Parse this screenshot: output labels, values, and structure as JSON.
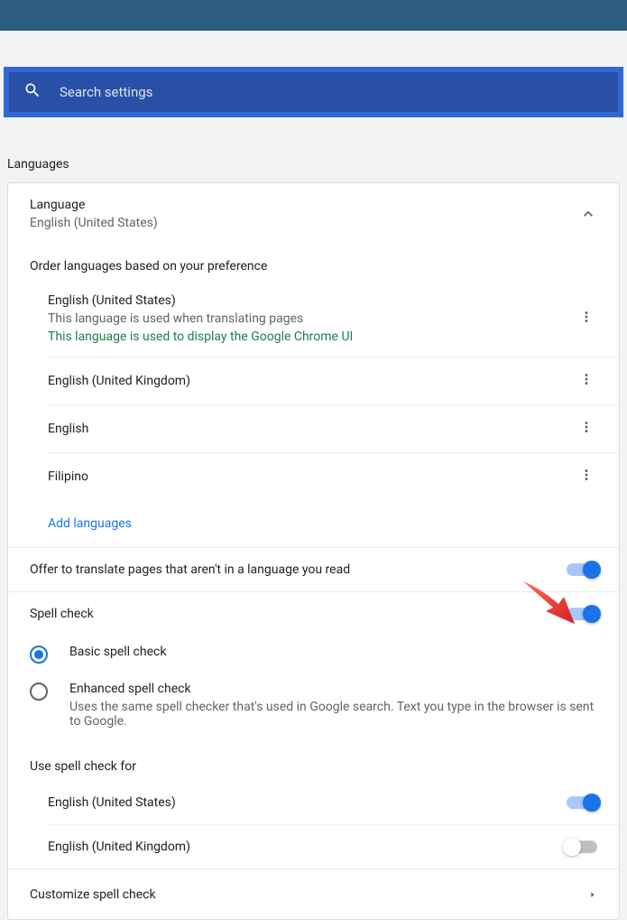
{
  "search": {
    "placeholder": "Search settings"
  },
  "section": {
    "title": "Languages"
  },
  "language_panel": {
    "heading": "Language",
    "current": "English (United States)"
  },
  "order_hint": "Order languages based on your preference",
  "languages": [
    {
      "name": "English (United States)",
      "sub": "This language is used when translating pages",
      "ui_note": "This language is used to display the Google Chrome UI"
    },
    {
      "name": "English (United Kingdom)"
    },
    {
      "name": "English"
    },
    {
      "name": "Filipino"
    }
  ],
  "add_languages": "Add languages",
  "translate_offer": "Offer to translate pages that aren't in a language you read",
  "spell_check": {
    "title": "Spell check",
    "basic": "Basic spell check",
    "enhanced": "Enhanced spell check",
    "enhanced_desc": "Uses the same spell checker that's used in Google search. Text you type in the browser is sent to Google.",
    "use_for": "Use spell check for",
    "langs": [
      {
        "name": "English (United States)",
        "enabled": true
      },
      {
        "name": "English (United Kingdom)",
        "enabled": false
      }
    ],
    "customize": "Customize spell check"
  }
}
